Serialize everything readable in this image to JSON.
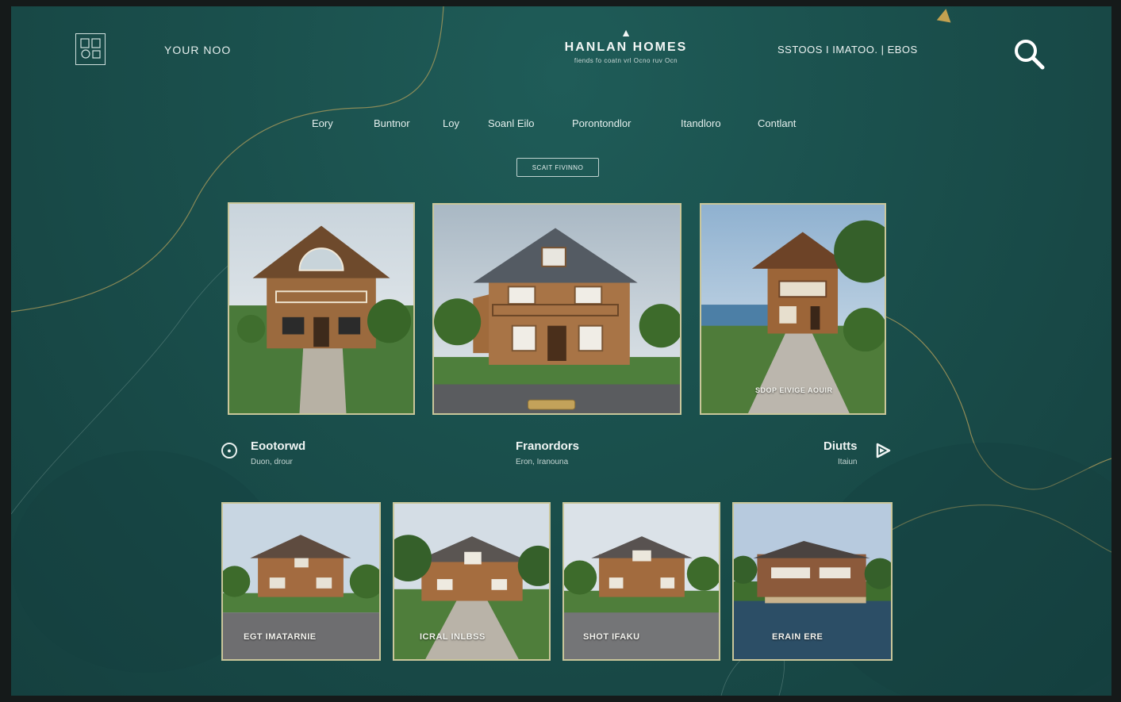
{
  "header": {
    "logo_mark": "⬚",
    "logo_text": "YOUR NOO",
    "brand_symbol": "▲",
    "brand_name": "HANLAN HOMES",
    "brand_tagline": "fiends fo coatn vrl Ocno ruv Ocn",
    "top_right_text": "SSTOOS I IMATOO. |  EBOS"
  },
  "nav": {
    "items": [
      "Eory",
      "Buntnor",
      "Loy",
      "Soanl Eilo",
      "Porontondlor",
      "Itandloro",
      "Contlant"
    ]
  },
  "cta": {
    "label": "SCAIT FIVINNO"
  },
  "featured": {
    "cards": [
      {
        "caption": ""
      },
      {
        "caption": ""
      },
      {
        "caption": "SDOP EIVIGE AOUIR"
      }
    ]
  },
  "info_row": {
    "left": {
      "title": "Eootorwd",
      "sub": "Duon, drour"
    },
    "center": {
      "title": "Franordors",
      "sub": "Eron, Iranouna"
    },
    "right": {
      "title": "Diutts",
      "sub": "Itaiun"
    }
  },
  "grid": {
    "cards": [
      {
        "caption": "EGT IMATARNIE"
      },
      {
        "caption": "ICRAL INLBSS"
      },
      {
        "caption": "SHOT IFAKU"
      },
      {
        "caption": "ERAIN ERE"
      }
    ]
  },
  "colors": {
    "background": "#1a4f4c",
    "frame_border": "#c9c69a",
    "accent_line": "#b9a25c"
  },
  "icons": {
    "search": "search-icon",
    "prev": "circle-icon",
    "next": "play-icon",
    "logo": "logo-icon"
  }
}
